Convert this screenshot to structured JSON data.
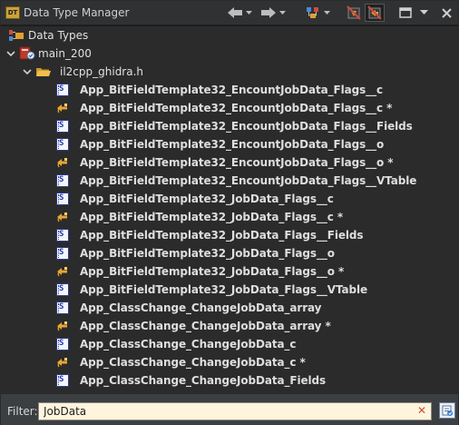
{
  "window": {
    "title": "Data Type Manager"
  },
  "toolbar": {
    "back_icon": "arrow-left-icon",
    "forward_icon": "arrow-right-icon",
    "dropdown_icon": "chevron-down-icon",
    "colors": {
      "accent_red": "#d04b3b",
      "icon_gold": "#e0a030"
    }
  },
  "tree": {
    "root_label": "Data Types",
    "archive_label": "main_200",
    "folder_label": "il2cpp_ghidra.h",
    "items": [
      {
        "label": "App_BitFieldTemplate32_EncountJobData_Flags__c",
        "kind": "structure"
      },
      {
        "label": "App_BitFieldTemplate32_EncountJobData_Flags__c *",
        "kind": "pointer"
      },
      {
        "label": "App_BitFieldTemplate32_EncountJobData_Flags__Fields",
        "kind": "structure"
      },
      {
        "label": "App_BitFieldTemplate32_EncountJobData_Flags__o",
        "kind": "structure"
      },
      {
        "label": "App_BitFieldTemplate32_EncountJobData_Flags__o *",
        "kind": "pointer"
      },
      {
        "label": "App_BitFieldTemplate32_EncountJobData_Flags__VTable",
        "kind": "structure"
      },
      {
        "label": "App_BitFieldTemplate32_JobData_Flags__c",
        "kind": "structure"
      },
      {
        "label": "App_BitFieldTemplate32_JobData_Flags__c *",
        "kind": "pointer"
      },
      {
        "label": "App_BitFieldTemplate32_JobData_Flags__Fields",
        "kind": "structure"
      },
      {
        "label": "App_BitFieldTemplate32_JobData_Flags__o",
        "kind": "structure"
      },
      {
        "label": "App_BitFieldTemplate32_JobData_Flags__o *",
        "kind": "pointer"
      },
      {
        "label": "App_BitFieldTemplate32_JobData_Flags__VTable",
        "kind": "structure"
      },
      {
        "label": "App_ClassChange_ChangeJobData_array",
        "kind": "structure"
      },
      {
        "label": "App_ClassChange_ChangeJobData_array *",
        "kind": "pointer"
      },
      {
        "label": "App_ClassChange_ChangeJobData_c",
        "kind": "structure"
      },
      {
        "label": "App_ClassChange_ChangeJobData_c *",
        "kind": "pointer"
      },
      {
        "label": "App_ClassChange_ChangeJobData_Fields",
        "kind": "structure"
      }
    ]
  },
  "filter": {
    "label": "Filter:",
    "value": "JobData"
  }
}
